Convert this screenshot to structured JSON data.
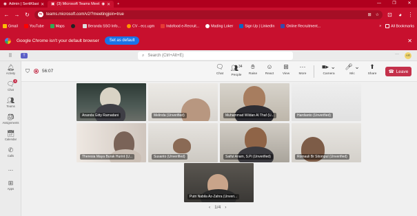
{
  "browser": {
    "tabs": [
      {
        "title": "Admin | SertiKlasi",
        "active": false
      },
      {
        "title": "(3) Microsoft Teams Meet",
        "active": true
      }
    ],
    "url": "teams.microsoft.com/v2/?meetingjoin=true",
    "bookmarks": [
      "Gmail",
      "YouTube",
      "Maps",
      "",
      "Beranda SSO Info...",
      "CV - ecc.ugm",
      "Indofood e-Recruit...",
      "Mading Loker",
      "Sign Up | LinkedIn",
      "Online Recruitment..."
    ],
    "all_bookmarks": "All Bookmarks",
    "default_banner": "Google Chrome isn't your default browser",
    "set_default": "Set as default"
  },
  "teams": {
    "search_placeholder": "Search (Ctrl+Alt+E)",
    "user_initials": "AR",
    "rail": [
      {
        "label": "Activity",
        "icon": "bell-icon"
      },
      {
        "label": "Chat",
        "icon": "chat-icon",
        "badge": "3"
      },
      {
        "label": "Teams",
        "icon": "teams-icon"
      },
      {
        "label": "Assignments",
        "icon": "assignments-icon"
      },
      {
        "label": "Calendar",
        "icon": "calendar-icon"
      },
      {
        "label": "Calls",
        "icon": "phone-icon"
      },
      {
        "label": "...",
        "icon": "more-icon"
      },
      {
        "label": "Apps",
        "icon": "apps-icon"
      }
    ],
    "meeting": {
      "timer": "56:07",
      "tools": [
        {
          "label": "Chat",
          "icon": "chat-icon"
        },
        {
          "label": "People",
          "icon": "people-icon",
          "count": "34"
        },
        {
          "label": "Raise",
          "icon": "hand-icon"
        },
        {
          "label": "React",
          "icon": "smile-icon"
        },
        {
          "label": "View",
          "icon": "grid-icon"
        },
        {
          "label": "More",
          "icon": "more-icon"
        }
      ],
      "devices": [
        {
          "label": "Camera",
          "icon": "camera-icon"
        },
        {
          "label": "Mic",
          "icon": "mic-icon"
        },
        {
          "label": "Share",
          "icon": "share-icon"
        }
      ],
      "leave": "Leave",
      "participants": [
        "Ananda Gitty Ramadani",
        "Melinda (Unverified)",
        "Muhammad Wildan Al Thaf (U...",
        "Hardianto (Unverified)",
        "Theresia Maya Burak Hurint (U...",
        "Susanto (Unverified)",
        "Saiful Anam, S.Pi (Unverified)",
        "Romauli Br Sitompul (Unverified)",
        "Putri Nabila Az-Zahra (Unveri..."
      ],
      "pager": "1/4"
    }
  }
}
